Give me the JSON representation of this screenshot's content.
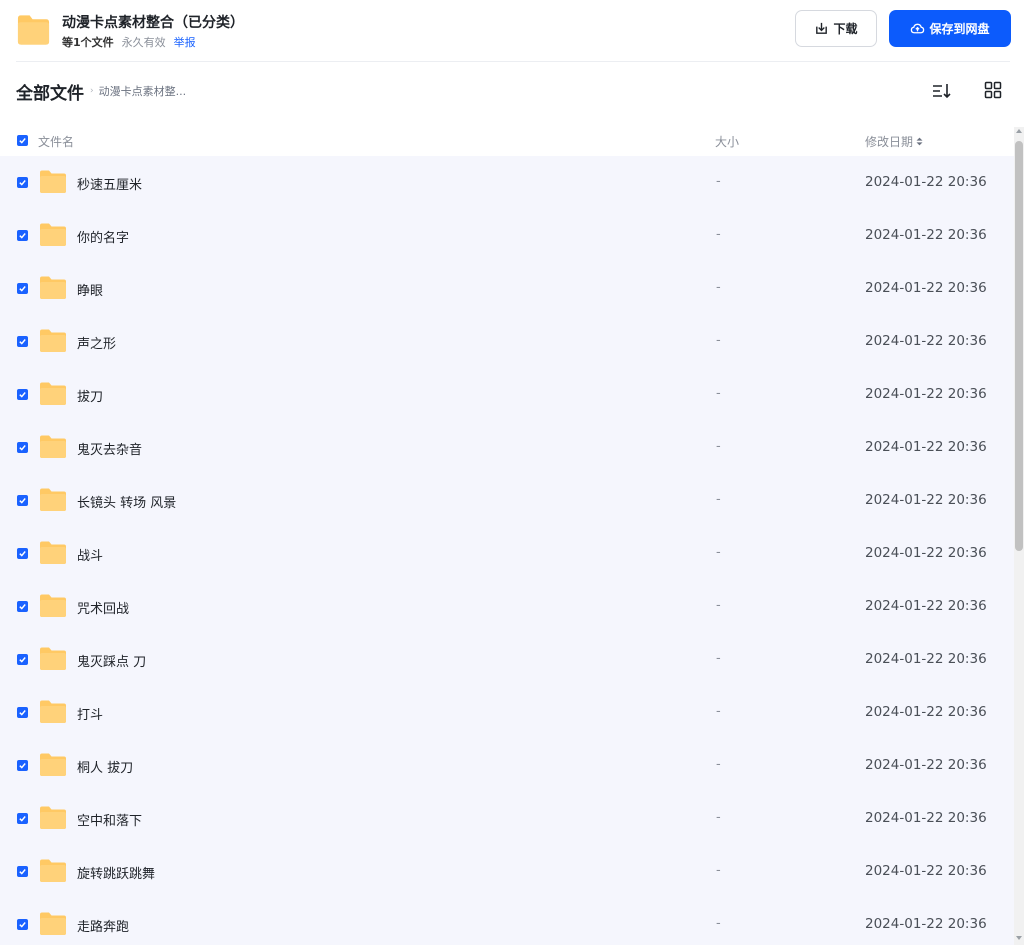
{
  "colors": {
    "accent": "#0c5bfc",
    "folder": "#ffc964",
    "list_bg": "#f5f6fd",
    "link": "#1a62ff"
  },
  "header": {
    "title": "动漫卡点素材整合（已分类）",
    "count": "等1个文件",
    "expiry": "永久有效",
    "report": "举报",
    "download_label": "下载",
    "save_label": "保存到网盘"
  },
  "breadcrumb": {
    "root": "全部文件",
    "separator": "›",
    "current": "动漫卡点素材整..."
  },
  "icons": [
    "folder-icon",
    "download-icon",
    "cloud-upload-icon",
    "sort-icon",
    "grid-view-icon",
    "checkbox-icon",
    "sort-caret-icon"
  ],
  "columns": {
    "name": "文件名",
    "size": "大小",
    "date": "修改日期"
  },
  "files": [
    {
      "name": "秒速五厘米",
      "size": "-",
      "date": "2024-01-22 20:36"
    },
    {
      "name": "你的名字",
      "size": "-",
      "date": "2024-01-22 20:36"
    },
    {
      "name": "睁眼",
      "size": "-",
      "date": "2024-01-22 20:36"
    },
    {
      "name": "声之形",
      "size": "-",
      "date": "2024-01-22 20:36"
    },
    {
      "name": "拔刀",
      "size": "-",
      "date": "2024-01-22 20:36"
    },
    {
      "name": "鬼灭去杂音",
      "size": "-",
      "date": "2024-01-22 20:36"
    },
    {
      "name": "长镜头 转场 风景",
      "size": "-",
      "date": "2024-01-22 20:36"
    },
    {
      "name": "战斗",
      "size": "-",
      "date": "2024-01-22 20:36"
    },
    {
      "name": "咒术回战",
      "size": "-",
      "date": "2024-01-22 20:36"
    },
    {
      "name": "鬼灭踩点 刀",
      "size": "-",
      "date": "2024-01-22 20:36"
    },
    {
      "name": "打斗",
      "size": "-",
      "date": "2024-01-22 20:36"
    },
    {
      "name": "桐人 拔刀",
      "size": "-",
      "date": "2024-01-22 20:36"
    },
    {
      "name": "空中和落下",
      "size": "-",
      "date": "2024-01-22 20:36"
    },
    {
      "name": "旋转跳跃跳舞",
      "size": "-",
      "date": "2024-01-22 20:36"
    },
    {
      "name": "走路奔跑",
      "size": "-",
      "date": "2024-01-22 20:36"
    }
  ]
}
